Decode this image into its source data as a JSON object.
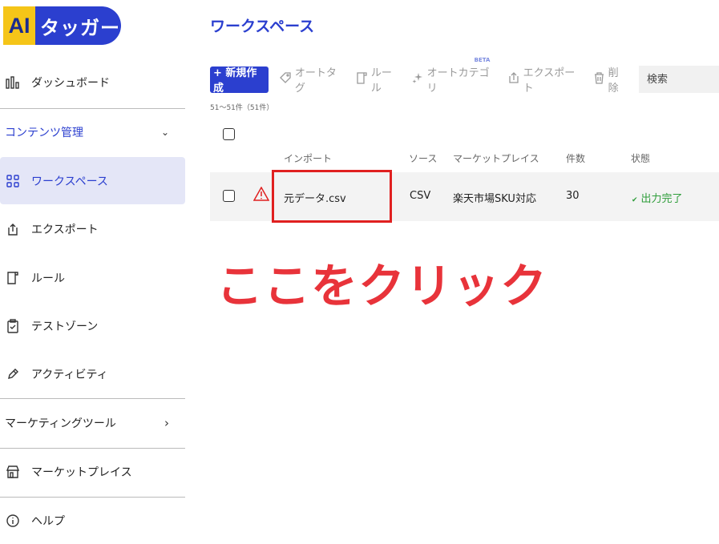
{
  "logo": {
    "ai": "AI",
    "name": "タッガー"
  },
  "sidebar": {
    "dashboard": "ダッシュボード",
    "content_mgmt": "コンテンツ管理",
    "content_chevron": "⌄",
    "workspace": "ワークスペース",
    "export": "エクスポート",
    "rules": "ルール",
    "testzone": "テストゾーン",
    "activity": "アクティビティ",
    "marketing_tools": "マーケティングツール",
    "marketing_chevron": "›",
    "marketplace": "マーケットプレイス",
    "help": "ヘルプ"
  },
  "main": {
    "title": "ワークスペース",
    "toolbar": {
      "new": "+ 新規作成",
      "autotag": "オートタグ",
      "rules": "ルール",
      "autocategory": "オートカテゴリ",
      "beta": "BETA",
      "export": "エクスポート",
      "delete": "削除",
      "search_placeholder": "検索"
    },
    "count": "51～51件（51件）",
    "columns": {
      "import": "インポート",
      "source": "ソース",
      "marketplace": "マーケットプレイス",
      "count": "件数",
      "status": "状態"
    },
    "row": {
      "file": "元データ.csv",
      "source": "CSV",
      "marketplace": "楽天市場SKU対応",
      "count": "30",
      "status": "出力完了"
    },
    "annotation": "ここをクリック"
  },
  "colors": {
    "brand": "#2b3fcf",
    "logo_yellow": "#f5c518",
    "success": "#2e9d3a",
    "annotation": "#e8333a"
  }
}
